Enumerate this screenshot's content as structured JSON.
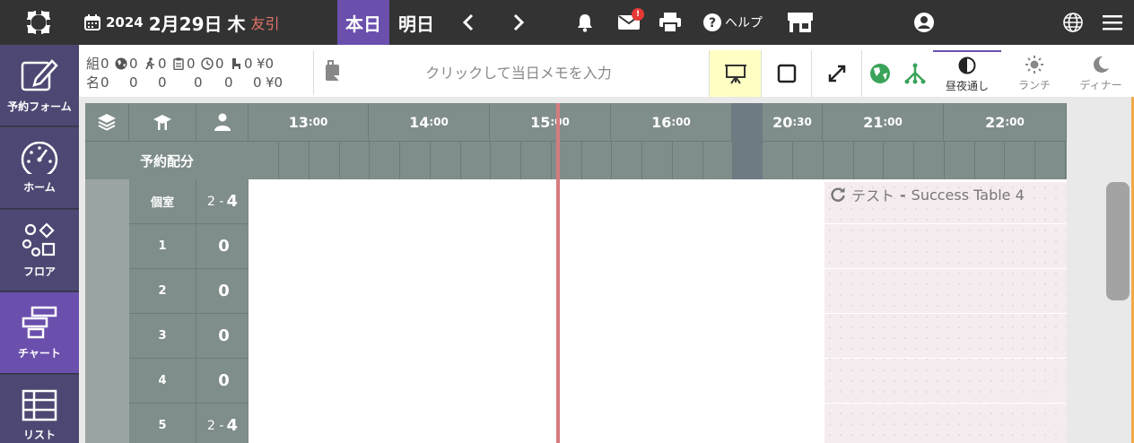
{
  "header": {
    "year": "2024",
    "month_day": "2月29日",
    "weekday": "木",
    "rokuyo": "友引",
    "today_label": "本日",
    "tomorrow_label": "明日",
    "mail_badge": "!",
    "help_label": "ヘルプ"
  },
  "sidebar": {
    "items": [
      {
        "label": "予約フォーム",
        "icon": "edit-icon"
      },
      {
        "label": "ホーム",
        "icon": "dashboard-icon"
      },
      {
        "label": "フロア",
        "icon": "shapes-icon"
      },
      {
        "label": "チャート",
        "icon": "chart-icon"
      },
      {
        "label": "リスト",
        "icon": "table-icon"
      }
    ]
  },
  "stats": {
    "row1_label": "組",
    "row2_label": "名",
    "groups": [
      "0",
      "0",
      "0",
      "0",
      "0",
      "0",
      "¥0"
    ],
    "people": [
      "0",
      "0",
      "0",
      "0",
      "0",
      "0",
      "¥0"
    ]
  },
  "memo": {
    "placeholder": "クリックして当日メモを入力"
  },
  "view_tabs": [
    {
      "label": "昼夜通し",
      "icon": "half-circle-icon",
      "active": true
    },
    {
      "label": "ランチ",
      "icon": "sun-icon",
      "active": false
    },
    {
      "label": "ディナー",
      "icon": "moon-icon",
      "active": false
    }
  ],
  "chart": {
    "allocation_label": "予約配分",
    "times": [
      {
        "h": "13",
        "m": ":00"
      },
      {
        "h": "14",
        "m": ":00"
      },
      {
        "h": "15",
        "m": ":00"
      },
      {
        "h": "16",
        "m": ":00"
      },
      {
        "h": "20",
        "m": ":30"
      },
      {
        "h": "21",
        "m": ":00"
      },
      {
        "h": "22",
        "m": ":00"
      }
    ],
    "rows": [
      {
        "name": "個室",
        "range": "2 -",
        "count": "4"
      },
      {
        "name": "1",
        "range": "",
        "count": "0"
      },
      {
        "name": "2",
        "range": "",
        "count": "0"
      },
      {
        "name": "3",
        "range": "",
        "count": "0"
      },
      {
        "name": "4",
        "range": "",
        "count": "0"
      },
      {
        "name": "5",
        "range": "2 -",
        "count": "4"
      }
    ],
    "booking": {
      "name": "テスト",
      "separator": "-",
      "table": "Success Table 4"
    }
  },
  "colors": {
    "accent": "#6a4fad",
    "topbar": "#333333",
    "grid_header": "#7f8d8b",
    "now_line": "#d47b80",
    "rokuyo": "#e57368",
    "badge": "#e53935"
  }
}
